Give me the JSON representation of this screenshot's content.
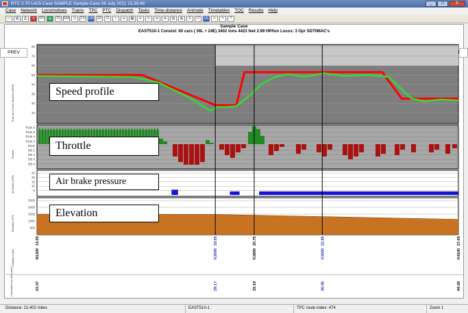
{
  "window": {
    "title": "RTC 2.70 L425   Case SAMPLE   Sample Case   08 July 2011  15:39:46",
    "minimize": "_",
    "maximize": "□",
    "close": "X"
  },
  "menu": [
    "Case",
    "Network",
    "Locomotives",
    "Trains",
    "TPC",
    "PTC",
    "Dispatch",
    "Tasks",
    "Time-distance",
    "Animate",
    "Timetables",
    "TOC",
    "Results",
    "Help"
  ],
  "toolbar": {
    "buttons": [
      "new",
      "open",
      "save",
      "print",
      "TPC",
      "user",
      "TO",
      "RRI",
      "TTC",
      "LB",
      "2D",
      "3D",
      "plot",
      "plot",
      "plot",
      "time",
      "fwd",
      "back",
      "zoom",
      "zoom",
      "table",
      "zoom",
      "LT",
      "UE",
      "undo",
      "redo",
      "help"
    ],
    "labels": {
      "tpc": "TPC",
      "to": "TO",
      "rri": "RRI",
      "ttc": "TTC",
      "lbs": "LBS",
      "twod": "2D",
      "threed": "21",
      "lt": "LT",
      "ue": "UE"
    }
  },
  "header": {
    "case_title": "Sample Case",
    "consist_line": "EAST510-1   Consist:  60 cars ( 36L + 24E)   3402 tons   4423 feet   2.99 HP/ton   Locos: 3 Opr  SD70MAC's"
  },
  "nav": {
    "prev": "PREV",
    "next": "NEXT"
  },
  "panels": {
    "speed": {
      "label": "Speed profile",
      "ylabel": "Train and Track Speeds (MPH)",
      "ticks": [
        "80",
        "70",
        "60",
        "50",
        "40",
        "30",
        "20",
        "10"
      ],
      "colors": {
        "limit": "#ff0000",
        "actual": "#33dd33",
        "background": "#808080"
      },
      "limit_mph": [
        {
          "mile": 14.05,
          "mph": 50
        },
        {
          "mile": 17.3,
          "mph": 50
        },
        {
          "mile": 19.55,
          "mph": 18
        },
        {
          "mile": 20.2,
          "mph": 18
        },
        {
          "mile": 20.45,
          "mph": 53
        },
        {
          "mile": 24.7,
          "mph": 53
        },
        {
          "mile": 25.3,
          "mph": 25
        },
        {
          "mile": 27.05,
          "mph": 25
        }
      ],
      "actual_mph": [
        {
          "mile": 14.05,
          "mph": 49
        },
        {
          "mile": 17.0,
          "mph": 48
        },
        {
          "mile": 17.8,
          "mph": 42
        },
        {
          "mile": 18.8,
          "mph": 25
        },
        {
          "mile": 19.4,
          "mph": 12
        },
        {
          "mile": 19.6,
          "mph": 16
        },
        {
          "mile": 19.9,
          "mph": 16
        },
        {
          "mile": 20.2,
          "mph": 17
        },
        {
          "mile": 20.6,
          "mph": 28
        },
        {
          "mile": 21.0,
          "mph": 41
        },
        {
          "mile": 21.4,
          "mph": 48
        },
        {
          "mile": 21.8,
          "mph": 51
        },
        {
          "mile": 22.3,
          "mph": 48
        },
        {
          "mile": 22.9,
          "mph": 52
        },
        {
          "mile": 23.5,
          "mph": 49
        },
        {
          "mile": 24.3,
          "mph": 50
        },
        {
          "mile": 24.9,
          "mph": 48
        },
        {
          "mile": 25.6,
          "mph": 25
        },
        {
          "mile": 26.0,
          "mph": 22
        },
        {
          "mile": 26.5,
          "mph": 24
        },
        {
          "mile": 27.05,
          "mph": 23
        }
      ]
    },
    "throttle": {
      "label": "Throttle",
      "ylabel": "Throttle",
      "ticks": [
        "RUN 8",
        "RUN 6",
        "RUN 4",
        "RUN 2",
        "IDLE",
        "DB 2",
        "DB 4",
        "DB 6",
        "DB 8"
      ],
      "colors": {
        "power": "#228822",
        "brake": "#aa1111",
        "background": "#a0a0a0"
      }
    },
    "brake": {
      "label": "Air brake pressure",
      "ylabel": "Air Brake (PSI)",
      "ticks": [
        "25",
        "20",
        "15",
        "10",
        "5"
      ],
      "color": "#1515d8",
      "applications": [
        {
          "start": 18.2,
          "end": 18.4,
          "psi": 6
        },
        {
          "start": 20.0,
          "end": 20.3,
          "psi": 4
        },
        {
          "start": 20.9,
          "end": 27.05,
          "psi": 4
        }
      ]
    },
    "elevation": {
      "label": "Elevation",
      "ylabel": "Elevation (FT)",
      "ticks": [
        "2500",
        "2000",
        "1500",
        "1000",
        "500"
      ],
      "color": "#c87322",
      "profile_ft": [
        {
          "mile": 14.05,
          "ft": 1500
        },
        {
          "mile": 19.55,
          "ft": 1480
        },
        {
          "mile": 27.05,
          "ft": 1120
        }
      ]
    }
  },
  "axis": {
    "mile_start": 14.05,
    "mile_end": 27.05,
    "markers": [
      {
        "mile": "19.55",
        "station": "K3000",
        "time": "29:17",
        "color": "#2b2bcf"
      },
      {
        "mile": "20.75",
        "station": "K3800",
        "time": "33:19",
        "color": "#000000"
      },
      {
        "mile": "22.85",
        "station": "K3000",
        "time": "36:06",
        "color": "#2b2bcf"
      }
    ],
    "start": {
      "mile": "14.05",
      "station": "N1300",
      "time": "23:37"
    },
    "end": {
      "mile": "27.05",
      "station": "K4100",
      "time": "44:28"
    },
    "display_nodes_label": "Display nodes",
    "cumulative_label": "Cumulative run time (min)"
  },
  "status": {
    "distance": "Distance:   22.402 miles",
    "train": "EAST510-1",
    "route_index": "TPC route index:   474",
    "zoom": "Zoom 1"
  }
}
